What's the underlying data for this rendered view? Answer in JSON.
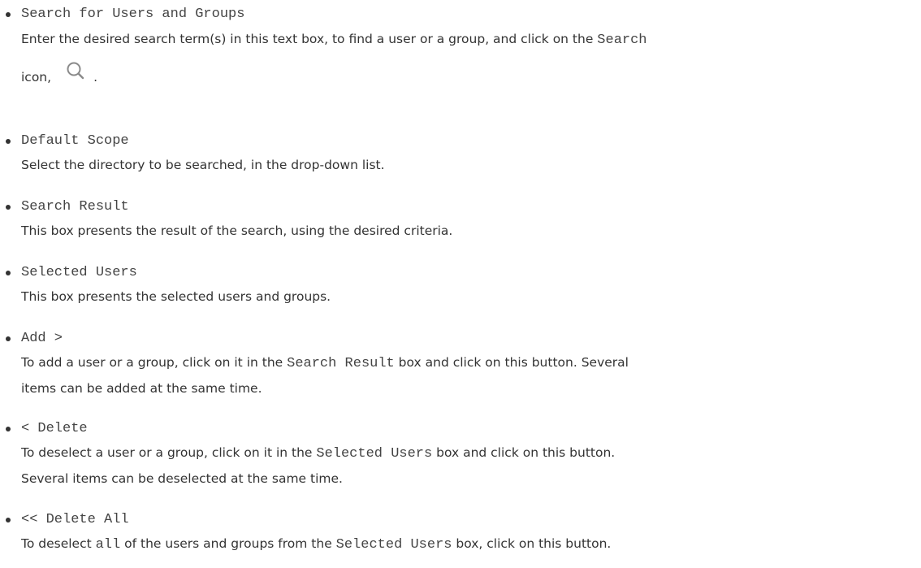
{
  "items": [
    {
      "term": "Search for Users and Groups",
      "desc_prefix": "Enter the desired search term(s) in this text box, to find a user or a group, and click on the ",
      "desc_code": "Search",
      "desc_line2_prefix": "icon,",
      "desc_line2_suffix": ".",
      "icon": "search-icon"
    },
    {
      "term": "Default Scope",
      "desc": "Select the directory to be searched, in the drop-down list."
    },
    {
      "term": "Search Result",
      "desc": "This box presents the result of the search, using the desired criteria."
    },
    {
      "term": "Selected Users",
      "desc": "This box presents the selected users and groups."
    },
    {
      "term": "Add >",
      "desc_prefix": "To add a user or a group, click on it in the ",
      "desc_code": "Search Result",
      "desc_suffix": " box and click on this button. Several",
      "desc_line2": "items can be added at the same time."
    },
    {
      "term": "< Delete",
      "desc_prefix": "To deselect a user or a group, click on it in the ",
      "desc_code": "Selected Users",
      "desc_suffix": " box and click on this button.",
      "desc_line2": "Several items can be deselected at the same time."
    },
    {
      "term": "<< Delete All",
      "desc_prefix": "To deselect ",
      "desc_code": "all",
      "desc_middle": " of the users and groups from the ",
      "desc_code2": "Selected Users",
      "desc_suffix": " box, click on this button."
    }
  ],
  "colors": {
    "text": "#333333",
    "code_text": "#444444",
    "icon": "#8a8a8a"
  }
}
